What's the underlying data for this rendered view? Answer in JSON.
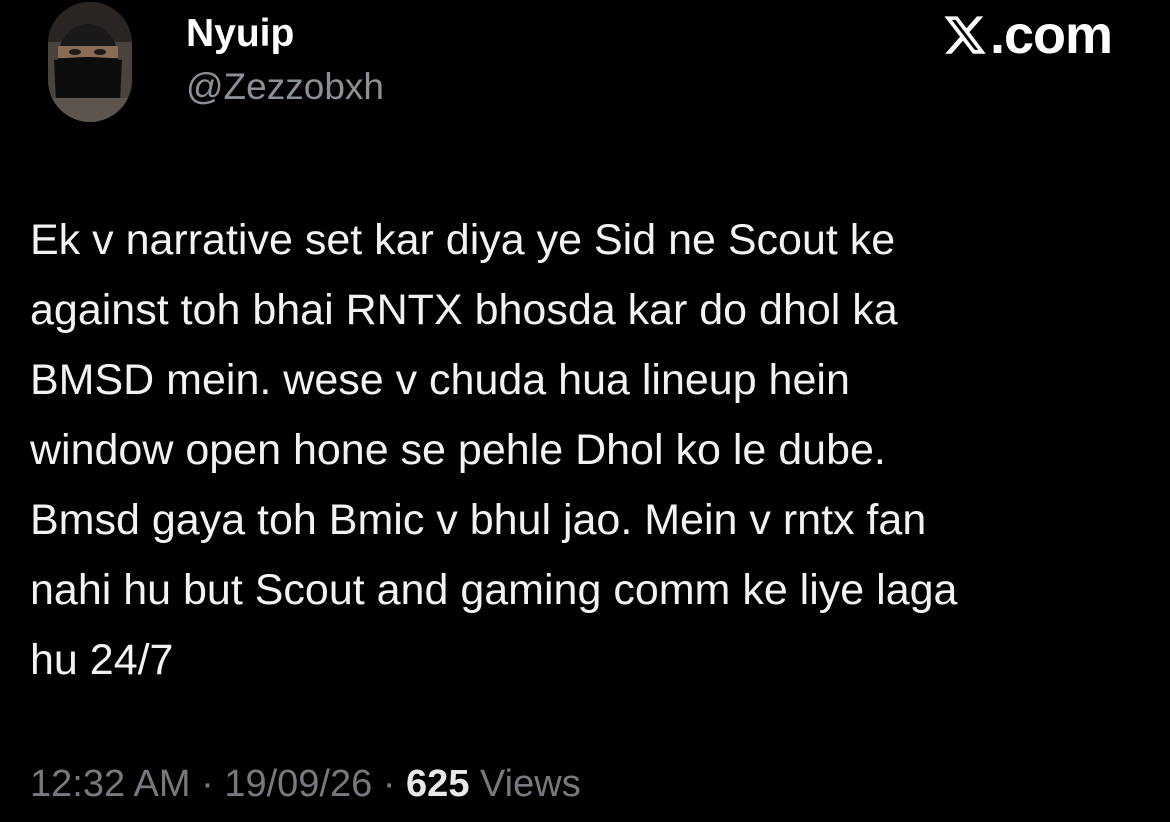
{
  "author": {
    "display_name": "Nyuip",
    "handle": "@Zezzobxh",
    "avatar_icon": "masked-person-avatar"
  },
  "brand": {
    "icon": "x-logo-icon",
    "domain": ".com"
  },
  "tweet": {
    "text": "Ek v narrative set kar diya ye Sid ne Scout ke\nagainst toh bhai RNTX bhosda kar do dhol ka\nBMSD mein. wese v chuda hua lineup hein\nwindow open hone se pehle Dhol ko le dube.\nBmsd gaya toh Bmic v bhul jao. Mein v rntx fan\nnahi hu but Scout and gaming comm ke liye laga\nhu 24/7"
  },
  "meta": {
    "time": "12:32 AM",
    "separator": "·",
    "date": "19/09/26",
    "views_count": "625",
    "views_label": "Views"
  },
  "colors": {
    "background": "#000000",
    "text": "#f2f2f2",
    "secondary": "#76797e"
  }
}
